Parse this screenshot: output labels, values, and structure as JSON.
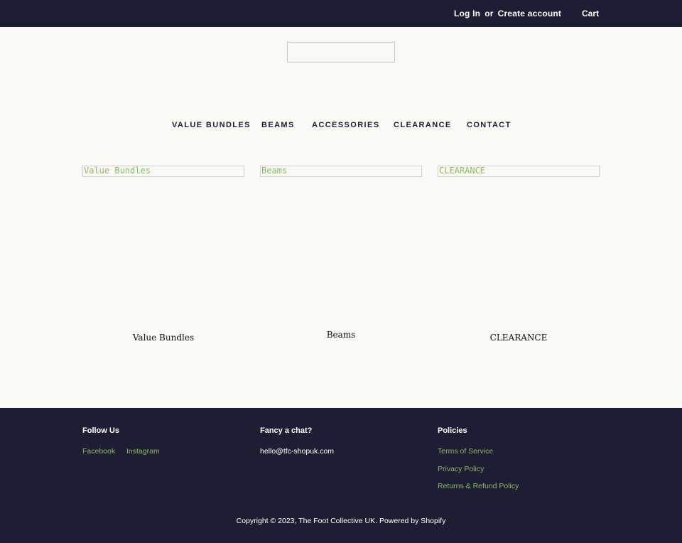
{
  "header": {
    "login_label": "Log In",
    "or_label": "or",
    "create_account_label": "Create account",
    "cart_label": "Cart"
  },
  "nav": {
    "items": [
      "VALUE BUNDLES",
      "BEAMS",
      "ACCESSORIES",
      "CLEARANCE",
      "CONTACT"
    ]
  },
  "collections": [
    {
      "image_alt": "Value Bundles",
      "title": "Value Bundles"
    },
    {
      "image_alt": "Beams",
      "title": "Beams"
    },
    {
      "image_alt": "CLEARANCE",
      "title": "CLEARANCE"
    }
  ],
  "footer": {
    "follow": {
      "heading": "Follow Us",
      "links": [
        "Facebook",
        "Instagram"
      ]
    },
    "chat": {
      "heading": "Fancy a chat?",
      "email": "hello@tfc-shopuk.com"
    },
    "policies": {
      "heading": "Policies",
      "links": [
        "Terms of Service",
        "Privacy Policy",
        "Returns & Refund Policy"
      ]
    },
    "copyright": "Copyright © 2023, The Foot Collective UK. Powered by Shopify"
  },
  "colors": {
    "dark_navy": "#1c1f33",
    "accent_green": "#8fb765",
    "background": "#faf9f6"
  }
}
